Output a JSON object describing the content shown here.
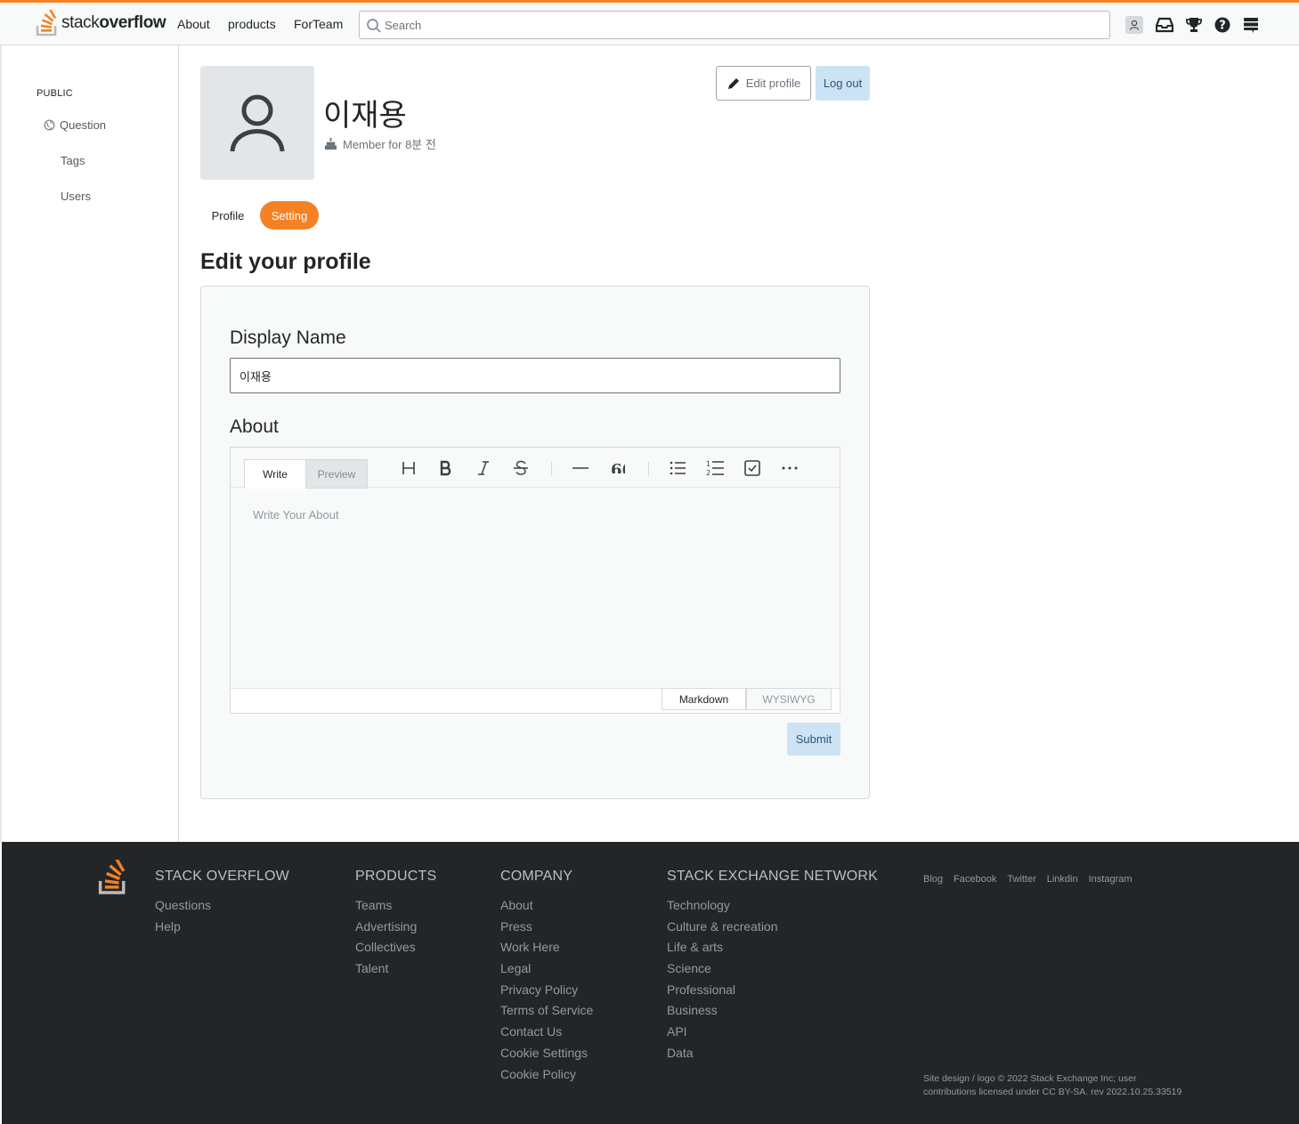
{
  "topbar": {
    "logo_light": "stack",
    "logo_bold": "overflow",
    "nav": [
      "About",
      "products",
      "ForTeam"
    ],
    "search_placeholder": "Search",
    "icons": [
      "user-avatar-icon",
      "inbox-icon",
      "trophy-icon",
      "help-icon",
      "stack-exchange-icon"
    ]
  },
  "sidebar": {
    "heading": "PUBLIC",
    "items": [
      {
        "label": "Question",
        "icon": "globe-icon"
      },
      {
        "label": "Tags"
      },
      {
        "label": "Users"
      }
    ]
  },
  "profile": {
    "name": "이재용",
    "member_since": "Member for 8분 전",
    "edit_button": "Edit profile",
    "logout_button": "Log out",
    "tabs": [
      "Profile",
      "Setting"
    ],
    "active_tab": "Setting"
  },
  "form": {
    "title": "Edit your profile",
    "display_name_label": "Display Name",
    "display_name_value": "이재용",
    "about_label": "About",
    "editor": {
      "tabs": [
        "Write",
        "Preview"
      ],
      "about_placeholder": "Write Your About",
      "tools": [
        "heading-icon",
        "bold-icon",
        "italic-icon",
        "strikethrough-icon",
        "horizontal-rule-icon",
        "blockquote-icon",
        "bulleted-list-icon",
        "numbered-list-icon",
        "task-list-icon",
        "more-icon"
      ],
      "modes": [
        "Markdown",
        "WYSIWYG"
      ]
    },
    "submit": "Submit"
  },
  "footer": {
    "columns": [
      {
        "title": "STACK OVERFLOW",
        "links": [
          "Questions",
          "Help"
        ]
      },
      {
        "title": "PRODUCTS",
        "links": [
          "Teams",
          "Advertising",
          "Collectives",
          "Talent"
        ]
      },
      {
        "title": "COMPANY",
        "links": [
          "About",
          "Press",
          "Work Here",
          "Legal",
          "Privacy Policy",
          "Terms of Service",
          "Contact Us",
          "Cookie Settings",
          "Cookie Policy"
        ]
      },
      {
        "title": "STACK EXCHANGE NETWORK",
        "links": [
          "Technology",
          "Culture & recreation",
          "Life & arts",
          "Science",
          "Professional",
          "Business",
          "API",
          "Data"
        ]
      }
    ],
    "social": [
      "Blog",
      "Facebook",
      "Twitter",
      "Linkdin",
      "Instagram"
    ],
    "copyright": "Site design / logo © 2022 Stack Exchange Inc; user contributions licensed under CC BY-SA. rev 2022.10.25.33519"
  },
  "colors": {
    "accent": "#f48225",
    "footer_bg": "#232629",
    "button_blue_bg": "#cce3f3",
    "button_blue_text": "#2c5877"
  }
}
